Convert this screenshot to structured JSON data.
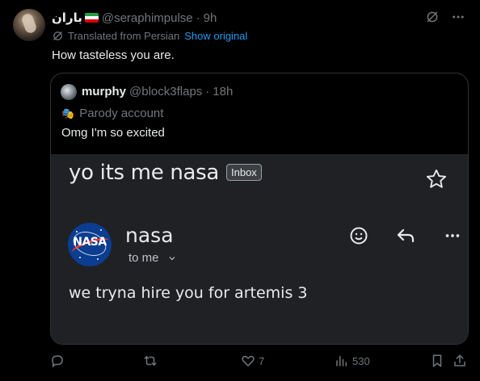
{
  "post": {
    "display_name": "باران",
    "handle": "@seraphimpulse",
    "separator": "·",
    "time": "9h",
    "translated_label": "Translated from Persian",
    "show_original": "Show original",
    "text": "How tasteless you are.",
    "flag_icon": "iran-flag-icon"
  },
  "quote": {
    "display_name": "murphy",
    "handle": "@block3flaps",
    "separator": "·",
    "time": "18h",
    "parody_label": "Parody account",
    "text": "Omg I'm so excited"
  },
  "email": {
    "subject": "yo its me nasa",
    "label_chip": "Inbox",
    "logo_text": "NASA",
    "sender": "nasa",
    "recipient": "to me",
    "body": "we tryna hire you for artemis 3"
  },
  "actions": {
    "likes": "7",
    "views": "530"
  },
  "colors": {
    "background": "#000000",
    "accent": "#1d9bf0",
    "muted": "#71767b",
    "email_bg": "#202124",
    "nasa_blue": "#0b3d91",
    "nasa_red": "#fc3d21"
  }
}
